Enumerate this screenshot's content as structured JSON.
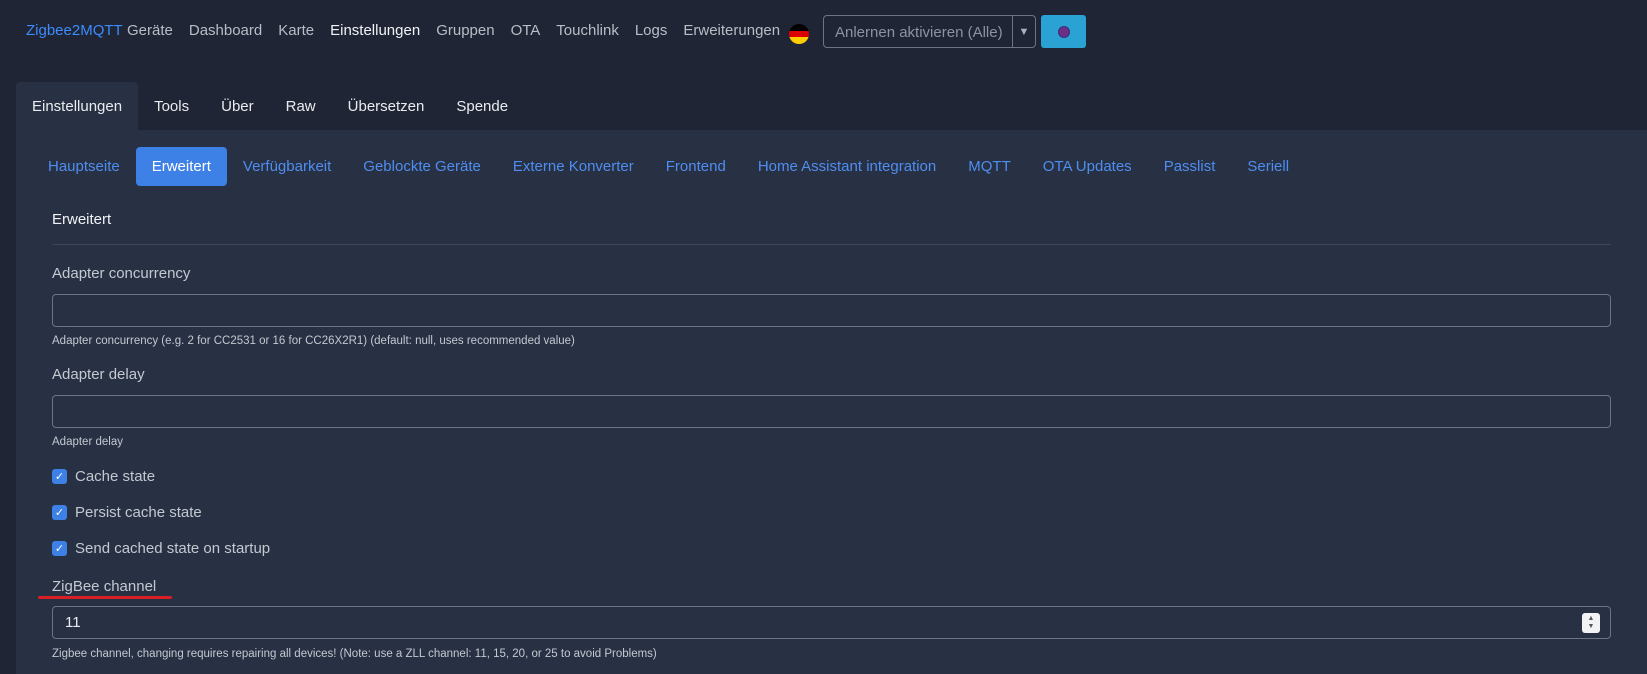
{
  "navbar": {
    "brand": "Zigbee2MQTT",
    "links": [
      "Geräte",
      "Dashboard",
      "Karte",
      "Einstellungen",
      "Gruppen",
      "OTA",
      "Touchlink",
      "Logs",
      "Erweiterungen"
    ],
    "active_link": "Einstellungen",
    "language_flag": "germany-flag-icon",
    "permit_join_label": "Anlernen aktivieren (Alle)",
    "theme_button_icon": "theme-toggle-icon"
  },
  "settings_tabs": [
    "Einstellungen",
    "Tools",
    "Über",
    "Raw",
    "Übersetzen",
    "Spende"
  ],
  "settings_active_tab": "Einstellungen",
  "sub_tabs": [
    "Hauptseite",
    "Erweitert",
    "Verfügbarkeit",
    "Geblockte Geräte",
    "Externe Konverter",
    "Frontend",
    "Home Assistant integration",
    "MQTT",
    "OTA Updates",
    "Passlist",
    "Seriell"
  ],
  "sub_active_tab": "Erweitert",
  "section": {
    "title": "Erweitert",
    "adapter_concurrency": {
      "label": "Adapter concurrency",
      "value": "",
      "help": "Adapter concurrency (e.g. 2 for CC2531 or 16 for CC26X2R1) (default: null, uses recommended value)"
    },
    "adapter_delay": {
      "label": "Adapter delay",
      "value": "",
      "help": "Adapter delay"
    },
    "checkboxes": [
      {
        "label": "Cache state",
        "checked": true
      },
      {
        "label": "Persist cache state",
        "checked": true
      },
      {
        "label": "Send cached state on startup",
        "checked": true
      }
    ],
    "zigbee_channel": {
      "label": "ZigBee channel",
      "value": "11",
      "help": "Zigbee channel, changing requires repairing all devices! (Note: use a ZLL channel: 11, 15, 20, or 25 to avoid Problems)"
    }
  },
  "colors": {
    "accent": "#3d80e6",
    "link": "#4f8ef0",
    "background": "#1f2535",
    "panel": "#283043",
    "highlight_underline": "#d81f26"
  }
}
